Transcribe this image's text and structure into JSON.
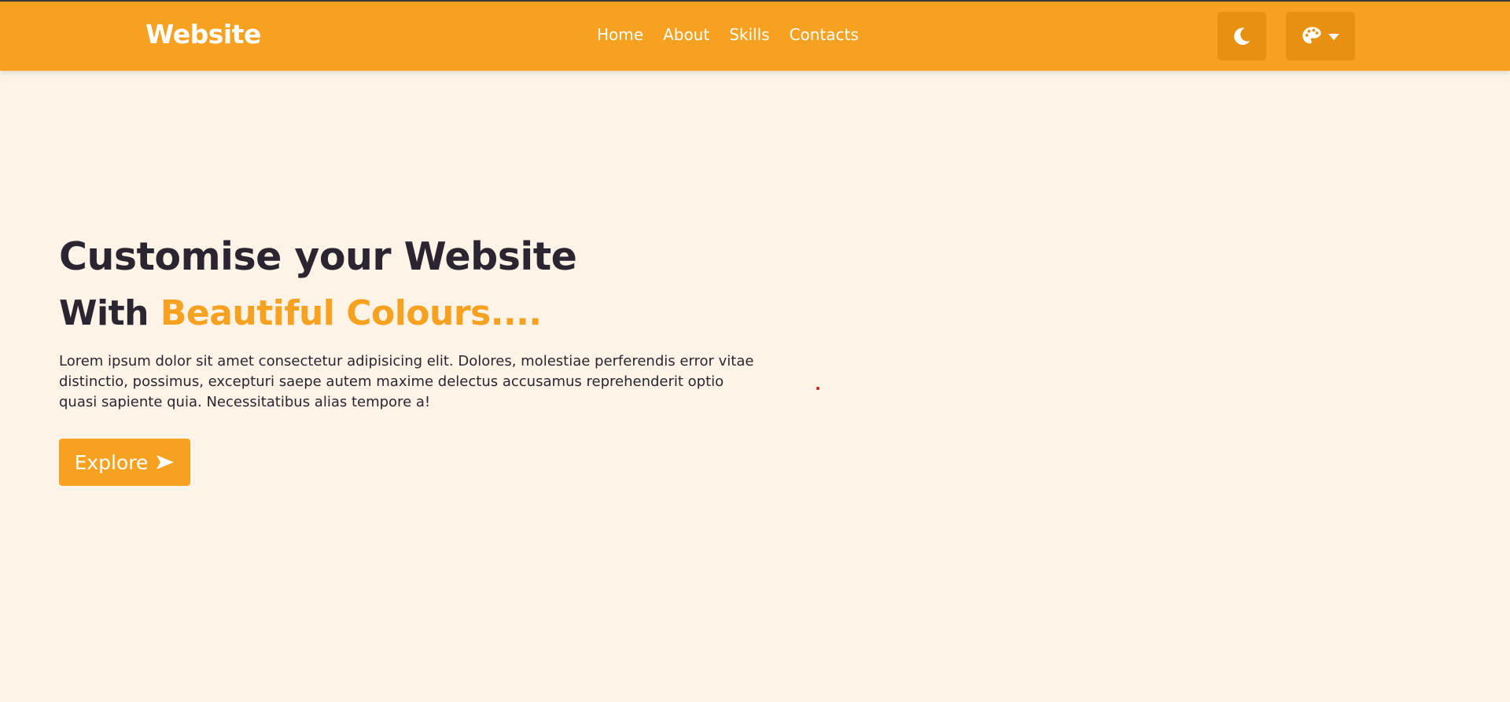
{
  "colors": {
    "accent": "#f7a120",
    "accent_dark": "#e8900f",
    "background": "#fdf3e6",
    "text_dark": "#2a2530"
  },
  "navbar": {
    "brand": "Website",
    "links": [
      {
        "label": "Home"
      },
      {
        "label": "About"
      },
      {
        "label": "Skills"
      },
      {
        "label": "Contacts"
      }
    ],
    "theme_toggle_icon": "moon-icon",
    "palette_icon": "palette-icon",
    "palette_dropdown_icon": "caret-down-icon"
  },
  "hero": {
    "title": "Customise your Website",
    "subtitle_prefix": "With",
    "subtitle_accent": "Beautiful Colours....",
    "paragraph": "Lorem ipsum dolor sit amet consectetur adipisicing elit. Dolores, molestiae perferendis error vitae distinctio, possimus, excepturi saepe autem maxime delectus accusamus reprehenderit optio quasi sapiente quia. Necessitatibus alias tempore a!",
    "button_label": "Explore",
    "button_icon": "arrow-right-icon"
  }
}
